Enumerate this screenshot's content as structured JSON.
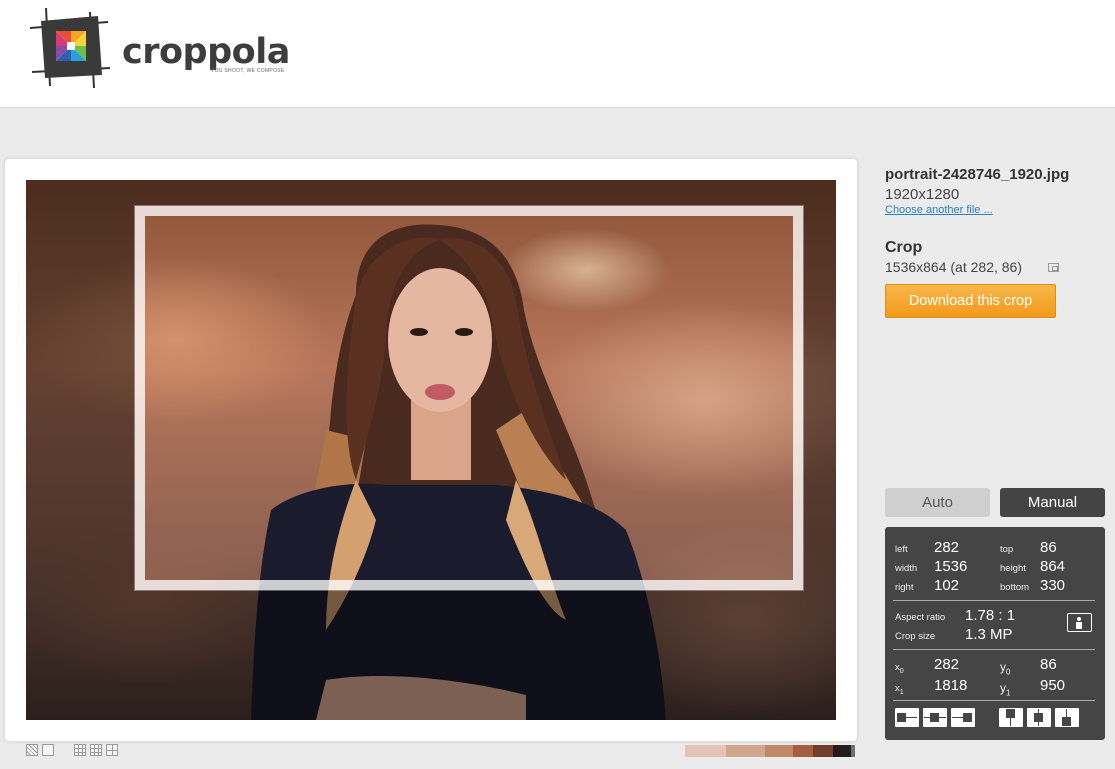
{
  "header": {
    "logo_text": "croppola",
    "tagline": "YOU SHOOT, WE COMPOSE"
  },
  "file": {
    "name": "portrait-2428746_1920.jpg",
    "dimensions": "1920x1280",
    "choose_another": "Choose another file ..."
  },
  "crop": {
    "title": "Crop",
    "info": "1536x864 (at 282, 86)",
    "download_label": "Download this crop"
  },
  "mode": {
    "auto_label": "Auto",
    "manual_label": "Manual",
    "selected": "Manual"
  },
  "panel": {
    "left_label": "left",
    "left": "282",
    "top_label": "top",
    "top": "86",
    "width_label": "width",
    "width": "1536",
    "height_label": "height",
    "height": "864",
    "right_label": "right",
    "right": "102",
    "bottom_label": "bottom",
    "bottom": "330",
    "aspect_label": "Aspect ratio",
    "aspect": "1.78 : 1",
    "size_label": "Crop size",
    "size": "1.3 MP",
    "x0_label": "x",
    "x0_sub": "0",
    "x0": "282",
    "y0_label": "y",
    "y0_sub": "0",
    "y0": "86",
    "x1_label": "x",
    "x1_sub": "1",
    "x1": "1818",
    "y1_label": "y",
    "y1_sub": "1",
    "y1": "950"
  },
  "palette": [
    "#e2c3b4",
    "#d1a78f",
    "#c08867",
    "#a55f3f",
    "#713d2c",
    "#241b1c",
    "#6f6f70"
  ],
  "colors": {
    "accent": "#f29a1a",
    "panel_bg": "#454545",
    "link": "#2a7fc1"
  },
  "icons": {
    "overlay_icons": [
      "hatch-overlay-icon",
      "blank-overlay-icon"
    ],
    "grid_icons": [
      "grid-thirds-icon",
      "grid-fine-icon",
      "grid-quarters-icon"
    ],
    "align_icons": [
      "align-left-icon",
      "align-center-h-icon",
      "align-right-icon",
      "align-top-icon",
      "align-center-v-icon",
      "align-bottom-icon"
    ]
  }
}
